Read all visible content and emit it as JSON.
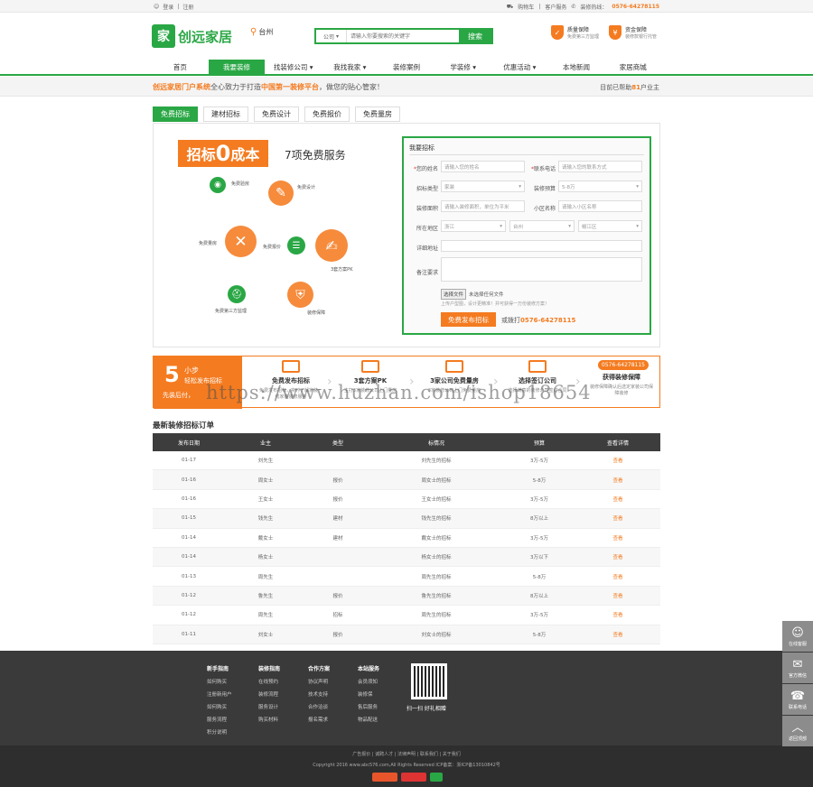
{
  "topbar": {
    "login": "登录",
    "register": "注册",
    "cart": "购物车",
    "service": "客户服务",
    "hotline_label": "装修热线：",
    "hotline": "0576-64278115"
  },
  "header": {
    "logo_glyph": "家",
    "logo_text": "创远家居",
    "city": "台州",
    "search_type": "公司",
    "search_placeholder": "请输入你要搜索的关键字",
    "search_button": "搜索",
    "guarantees": [
      {
        "title": "质量保障",
        "desc": "免费第三方监理"
      },
      {
        "title": "资金保障",
        "desc": "装修款银行托管"
      }
    ]
  },
  "nav": [
    "首页",
    "我要装修",
    "找装修公司 ▾",
    "我找我家 ▾",
    "装修案例",
    "学装修 ▾",
    "优惠活动 ▾",
    "本地新闻",
    "家居商城"
  ],
  "slogan": {
    "brand": "创远家居门户系统",
    "mid": "全心致力于打造",
    "highlight": "中国第一装修平台",
    "tail": "，做您的贴心管家！",
    "right_prefix": "目前已帮助",
    "right_num": "81",
    "right_suffix": "户业主"
  },
  "tabs": [
    "免费招标",
    "建材招标",
    "免费设计",
    "免费报价",
    "免费量房"
  ],
  "hero": {
    "pre": "招标",
    "zero": "0",
    "post": "成本",
    "sub": "7项免费服务",
    "services": [
      "免费验房",
      "免费设计",
      "免费量房",
      "免费报价",
      "3套方案PK",
      "免费第三方监理",
      "装修保障"
    ]
  },
  "form": {
    "title": "我要招标",
    "name_label": "您的姓名",
    "name_ph": "请输入您的姓名",
    "phone_label": "联系电话",
    "phone_ph": "请输入您的联系方式",
    "type_label": "招标类型",
    "type_val": "家装",
    "budget_label": "装修预算",
    "budget_val": "5-8万",
    "area_label": "装修面积",
    "area_ph": "请输入装修面积，单位为平米",
    "community_label": "小区名称",
    "community_ph": "请输入小区名称",
    "region_label": "所在地区",
    "province": "浙江",
    "city": "台州",
    "district": "椒江区",
    "address_label": "详细地址",
    "note_label": "备注要求",
    "upload_btn": "选择文件",
    "upload_status": "未选择任何文件",
    "upload_hint": "上传户型图，设计更精准！并可获得一万份装修方案！",
    "submit": "免费发布招标",
    "or_call": "或拨打",
    "phone": "0576-64278115"
  },
  "steps": {
    "num": "5",
    "t1": "小步",
    "t2": "轻松发布招标",
    "t3": "先装后付，",
    "items": [
      {
        "h": "免费发布招标",
        "d": "免费发布招标，实时了解家装一线家装装修服务"
      },
      {
        "h": "3套方案PK",
        "d": "主打3家装修公司上门量房"
      },
      {
        "h": "3家公司免费量房",
        "d": "3家装修公司上门免费量房"
      },
      {
        "h": "选择签订公司",
        "d": "选择满意的装修公司签订合同"
      },
      {
        "h": "获得装修保障",
        "d": "装修保障确认后选定家装公司保障装修"
      }
    ],
    "hotline": "0576-64278115"
  },
  "watermark": "https://www.huzhan.com/ishop18654",
  "orders": {
    "title": "最新装修招标订单",
    "headers": [
      "发布日期",
      "业主",
      "类型",
      "标情况",
      "预算",
      "查看详情"
    ],
    "rows": [
      [
        "01-17",
        "刘先生",
        "",
        "刘先生的招标",
        "3万-5万",
        "查看"
      ],
      [
        "01-16",
        "周女士",
        "报价",
        "周女士的招标",
        "5-8万",
        "查看"
      ],
      [
        "01-16",
        "王女士",
        "报价",
        "王女士的招标",
        "3万-5万",
        "查看"
      ],
      [
        "01-15",
        "钱先生",
        "建材",
        "钱先生的招标",
        "8万以上",
        "查看"
      ],
      [
        "01-14",
        "戴女士",
        "建材",
        "戴女士的招标",
        "3万-5万",
        "查看"
      ],
      [
        "01-14",
        "杨女士",
        "",
        "杨女士的招标",
        "3万以下",
        "查看"
      ],
      [
        "01-13",
        "周先生",
        "",
        "周先生的招标",
        "5-8万",
        "查看"
      ],
      [
        "01-12",
        "鲁先生",
        "报价",
        "鲁先生的招标",
        "8万以上",
        "查看"
      ],
      [
        "01-12",
        "周先生",
        "招标",
        "周先生的招标",
        "3万-5万",
        "查看"
      ],
      [
        "01-11",
        "刘女士",
        "报价",
        "刘女士的招标",
        "5-8万",
        "查看"
      ]
    ]
  },
  "footer": {
    "cols": [
      {
        "h": "新手指南",
        "items": [
          "如何购买",
          "注册新用户",
          "如何购买",
          "服务流程",
          "积分说明"
        ]
      },
      {
        "h": "装修指南",
        "items": [
          "在线预约",
          "装修流程",
          "服务设计",
          "购买材料"
        ]
      },
      {
        "h": "合作方案",
        "items": [
          "协议声明",
          "技术支持",
          "合作洽谈",
          "报名需求"
        ]
      },
      {
        "h": "本站服务",
        "items": [
          "会员须知",
          "装修保",
          "售后服务",
          "物品配送"
        ]
      }
    ],
    "qr_text": "扫一扫 好礼相赠",
    "links": "广告报价 | 诚聘人才 | 法律声明 | 联系我们 | 关于我们",
    "copyright": "Copyright 2016 www.abc576.com,All Rights Reserved ICP备案：浙ICP备13010842号"
  },
  "tools": [
    {
      "glyph": "☺",
      "label": "在线客服"
    },
    {
      "glyph": "✉",
      "label": "官方微信"
    },
    {
      "glyph": "☎",
      "label": "联系电话"
    },
    {
      "glyph": "︿",
      "label": "返回顶部"
    }
  ],
  "colors": {
    "brand": "#2aa745",
    "accent": "#f47b20"
  }
}
